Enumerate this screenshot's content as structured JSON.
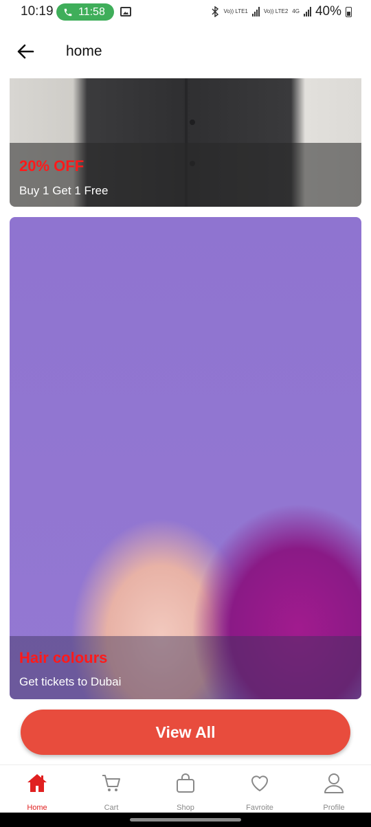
{
  "status_bar": {
    "time": "10:19",
    "call_duration": "11:58",
    "net1": "Vo)) LTE1",
    "net2": "Vo)) LTE2",
    "net3": "4G",
    "battery": "40%"
  },
  "app_bar": {
    "title": "home"
  },
  "cards": [
    {
      "heading": "20% OFF",
      "subtitle": "Buy 1 Get 1 Free"
    },
    {
      "heading": "Hair colours",
      "subtitle": "Get tickets to Dubai"
    }
  ],
  "view_all_label": "View All",
  "bottom_nav": {
    "items": [
      {
        "label": "Home",
        "icon": "home-icon",
        "active": true
      },
      {
        "label": "Cart",
        "icon": "cart-icon"
      },
      {
        "label": "Shop",
        "icon": "shopping-bag-icon"
      },
      {
        "label": "Favroite",
        "icon": "heart-icon"
      },
      {
        "label": "Profile",
        "icon": "person-icon"
      }
    ]
  },
  "colors": {
    "accent": "#e84c3d",
    "heading_red": "#ff1a1a",
    "active_nav": "#e02020"
  }
}
